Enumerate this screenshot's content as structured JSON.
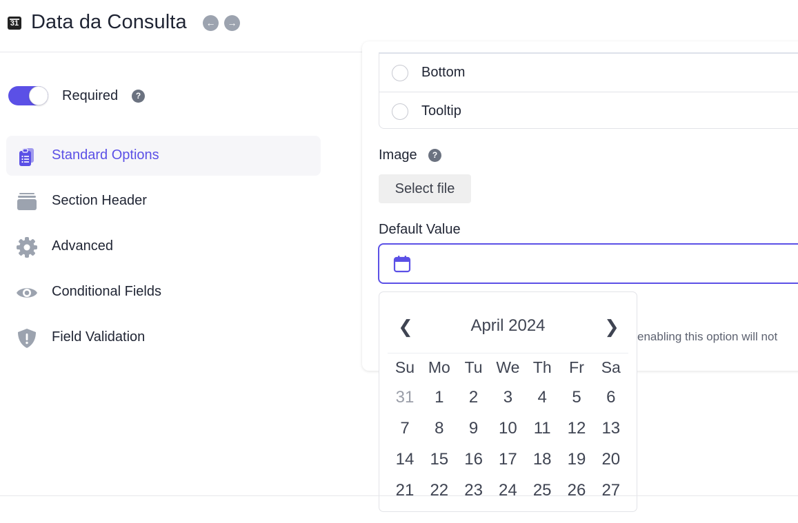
{
  "header": {
    "icon_text": "31",
    "title": "Data da Consulta",
    "back_glyph": "←",
    "forward_glyph": "→"
  },
  "sidebar": {
    "required": {
      "label": "Required",
      "toggle_on": true,
      "help_glyph": "?"
    },
    "items": [
      {
        "label": "Standard Options",
        "icon": "clipboard-list-icon",
        "active": true
      },
      {
        "label": "Section Header",
        "icon": "layers-icon",
        "active": false
      },
      {
        "label": "Advanced",
        "icon": "gear-icon",
        "active": false
      },
      {
        "label": "Conditional Fields",
        "icon": "eye-icon",
        "active": false
      },
      {
        "label": "Field Validation",
        "icon": "shield-alert-icon",
        "active": false
      }
    ]
  },
  "main": {
    "label_position_options": [
      {
        "label": "Bottom",
        "selected": false
      },
      {
        "label": "Tooltip",
        "selected": false
      }
    ],
    "image": {
      "label": "Image",
      "help_glyph": "?",
      "button_label": "Select file"
    },
    "default_value": {
      "label": "Default Value",
      "value": "",
      "icon": "calendar-icon"
    },
    "hint_text": "enabling this option will not"
  },
  "datepicker": {
    "month_label": "April 2024",
    "prev_glyph": "❮",
    "next_glyph": "❯",
    "weekdays": [
      "Su",
      "Mo",
      "Tu",
      "We",
      "Th",
      "Fr",
      "Sa"
    ],
    "weeks": [
      [
        "31",
        "1",
        "2",
        "3",
        "4",
        "5",
        "6"
      ],
      [
        "7",
        "8",
        "9",
        "10",
        "11",
        "12",
        "13"
      ],
      [
        "14",
        "15",
        "16",
        "17",
        "18",
        "19",
        "20"
      ],
      [
        "21",
        "22",
        "23",
        "24",
        "25",
        "26",
        "27"
      ]
    ],
    "outside_month_days": [
      "31"
    ]
  },
  "colors": {
    "accent": "#5b50e6",
    "text": "#1f2433",
    "icon_gray": "#6b7280"
  }
}
